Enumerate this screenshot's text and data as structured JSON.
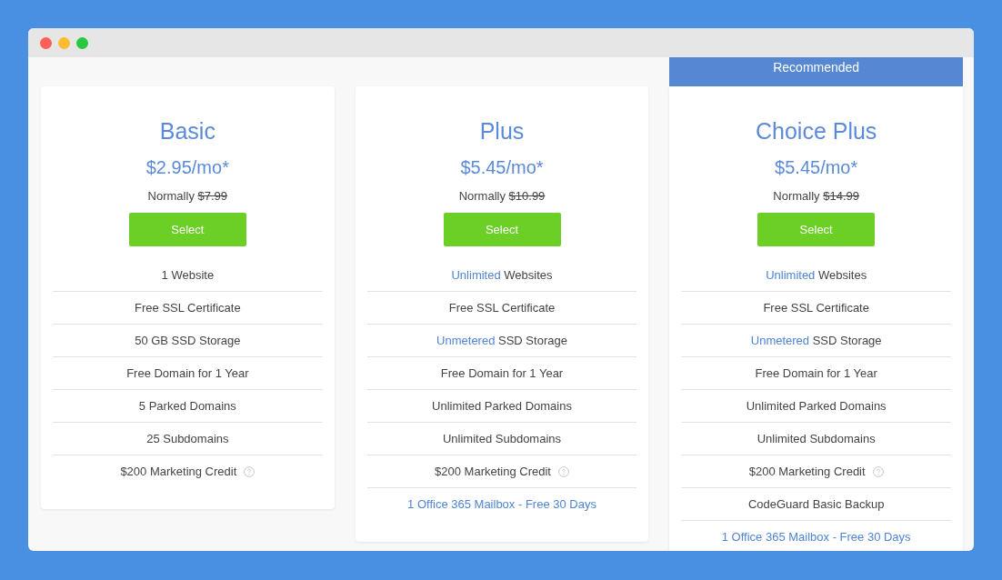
{
  "plans": [
    {
      "name": "Basic",
      "price": "$2.95/mo*",
      "normally": "Normally",
      "old_price": "$7.99",
      "button": "Select",
      "features": [
        {
          "kind": "plain",
          "text": "1 Website"
        },
        {
          "kind": "plain",
          "text": "Free SSL Certificate"
        },
        {
          "kind": "plain",
          "text": "50 GB SSD Storage"
        },
        {
          "kind": "plain",
          "text": "Free Domain for 1 Year"
        },
        {
          "kind": "plain",
          "text": "5 Parked Domains"
        },
        {
          "kind": "plain",
          "text": "25 Subdomains"
        },
        {
          "kind": "plain",
          "text": "$200 Marketing Credit",
          "help": true
        }
      ]
    },
    {
      "name": "Plus",
      "price": "$5.45/mo*",
      "normally": "Normally",
      "old_price": "$10.99",
      "button": "Select",
      "features": [
        {
          "kind": "plain",
          "accent": "Unlimited",
          "text": "Websites"
        },
        {
          "kind": "plain",
          "text": "Free SSL Certificate"
        },
        {
          "kind": "plain",
          "accent": "Unmetered",
          "text": "SSD Storage"
        },
        {
          "kind": "plain",
          "text": "Free Domain for 1 Year"
        },
        {
          "kind": "plain",
          "text": "Unlimited Parked Domains"
        },
        {
          "kind": "plain",
          "text": "Unlimited Subdomains"
        },
        {
          "kind": "plain",
          "text": "$200 Marketing Credit",
          "help": true
        },
        {
          "kind": "link",
          "text": "1 Office 365 Mailbox - Free 30 Days"
        }
      ]
    },
    {
      "name": "Choice Plus",
      "banner": "Recommended",
      "price": "$5.45/mo*",
      "normally": "Normally",
      "old_price": "$14.99",
      "button": "Select",
      "features": [
        {
          "kind": "plain",
          "accent": "Unlimited",
          "text": "Websites"
        },
        {
          "kind": "plain",
          "text": "Free SSL Certificate"
        },
        {
          "kind": "plain",
          "accent": "Unmetered",
          "text": "SSD Storage"
        },
        {
          "kind": "plain",
          "text": "Free Domain for 1 Year"
        },
        {
          "kind": "plain",
          "text": "Unlimited Parked Domains"
        },
        {
          "kind": "plain",
          "text": "Unlimited Subdomains"
        },
        {
          "kind": "plain",
          "text": "$200 Marketing Credit",
          "help": true
        },
        {
          "kind": "plain",
          "text": "CodeGuard Basic Backup"
        },
        {
          "kind": "link",
          "text": "1 Office 365 Mailbox - Free 30 Days"
        }
      ]
    }
  ]
}
